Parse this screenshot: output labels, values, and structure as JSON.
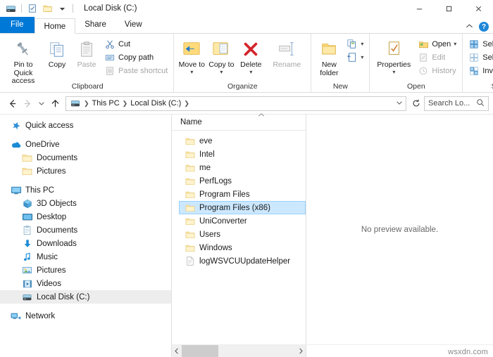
{
  "window": {
    "title": "Local Disk (C:)",
    "quick_access_icons": [
      "drive-icon",
      "properties-icon",
      "new-folder-icon",
      "customize-qat-chevron"
    ],
    "controls": {
      "minimize": "minimize-icon",
      "maximize": "maximize-icon",
      "close": "close-icon"
    },
    "ribbon_collapse": "chevron-up-icon",
    "help": "?"
  },
  "tabs": [
    {
      "label": "File",
      "state": "file"
    },
    {
      "label": "Home",
      "state": "active"
    },
    {
      "label": "Share",
      "state": "normal"
    },
    {
      "label": "View",
      "state": "normal"
    }
  ],
  "ribbon": {
    "groups": [
      {
        "label": "Clipboard",
        "big": [
          {
            "label": "Pin to Quick access",
            "icon": "pin-icon",
            "disabled": false
          },
          {
            "label": "Copy",
            "icon": "copy-icon",
            "disabled": false
          },
          {
            "label": "Paste",
            "icon": "paste-icon",
            "disabled": true
          }
        ],
        "small": [
          {
            "label": "Cut",
            "icon": "scissors-icon",
            "disabled": false
          },
          {
            "label": "Copy path",
            "icon": "copy-path-icon",
            "disabled": false
          },
          {
            "label": "Paste shortcut",
            "icon": "paste-shortcut-icon",
            "disabled": true
          }
        ]
      },
      {
        "label": "Organize",
        "big": [
          {
            "label": "Move to",
            "icon": "move-to-icon",
            "disabled": false,
            "caret": true
          },
          {
            "label": "Copy to",
            "icon": "copy-to-icon",
            "disabled": false,
            "caret": true
          },
          {
            "label": "Delete",
            "icon": "delete-x-icon",
            "disabled": false,
            "caret": true
          },
          {
            "label": "Rename",
            "icon": "rename-icon",
            "disabled": true
          }
        ],
        "small": []
      },
      {
        "label": "New",
        "big": [
          {
            "label": "New folder",
            "icon": "new-folder-icon",
            "disabled": false
          }
        ],
        "small": [
          {
            "label": "",
            "icon": "new-item-icon",
            "disabled": false,
            "caret": true
          },
          {
            "label": "",
            "icon": "easy-access-icon",
            "disabled": false,
            "caret": true
          }
        ]
      },
      {
        "label": "Open",
        "big": [
          {
            "label": "Properties",
            "icon": "properties-icon",
            "disabled": false,
            "caret": true
          }
        ],
        "small": [
          {
            "label": "Open",
            "icon": "open-icon",
            "disabled": false,
            "caret": true
          },
          {
            "label": "Edit",
            "icon": "edit-icon",
            "disabled": true
          },
          {
            "label": "History",
            "icon": "history-icon",
            "disabled": true
          }
        ]
      },
      {
        "label": "Select",
        "big": [],
        "small": [
          {
            "label": "Select all",
            "icon": "select-all-icon",
            "disabled": false
          },
          {
            "label": "Select none",
            "icon": "select-none-icon",
            "disabled": false
          },
          {
            "label": "Invert selection",
            "icon": "invert-selection-icon",
            "disabled": false
          }
        ]
      }
    ]
  },
  "addressbar": {
    "back": "back-arrow-icon",
    "forward": "forward-arrow-icon",
    "recent": "chevron-down-icon",
    "up": "up-arrow-icon",
    "path_icon": "drive-icon",
    "crumbs": [
      "This PC",
      "Local Disk (C:)"
    ],
    "dropdown": "chevron-down-icon",
    "refresh": "refresh-icon",
    "search_placeholder": "Search Lo...",
    "search_value": "",
    "search_icon": "search-icon"
  },
  "navpane": {
    "items": [
      {
        "label": "Quick access",
        "icon": "star-pin-icon",
        "indent": false,
        "selected": false,
        "gap_before": false
      },
      {
        "label": "OneDrive",
        "icon": "cloud-icon",
        "indent": false,
        "selected": false,
        "gap_before": true
      },
      {
        "label": "Documents",
        "icon": "folder-icon",
        "indent": true,
        "selected": false,
        "gap_before": false
      },
      {
        "label": "Pictures",
        "icon": "folder-icon",
        "indent": true,
        "selected": false,
        "gap_before": false
      },
      {
        "label": "This PC",
        "icon": "monitor-icon",
        "indent": false,
        "selected": false,
        "gap_before": true
      },
      {
        "label": "3D Objects",
        "icon": "cube-icon",
        "indent": true,
        "selected": false,
        "gap_before": false
      },
      {
        "label": "Desktop",
        "icon": "desktop-icon",
        "indent": true,
        "selected": false,
        "gap_before": false
      },
      {
        "label": "Documents",
        "icon": "documents-icon",
        "indent": true,
        "selected": false,
        "gap_before": false
      },
      {
        "label": "Downloads",
        "icon": "download-icon",
        "indent": true,
        "selected": false,
        "gap_before": false
      },
      {
        "label": "Music",
        "icon": "music-note-icon",
        "indent": true,
        "selected": false,
        "gap_before": false
      },
      {
        "label": "Pictures",
        "icon": "pictures-icon",
        "indent": true,
        "selected": false,
        "gap_before": false
      },
      {
        "label": "Videos",
        "icon": "videos-icon",
        "indent": true,
        "selected": false,
        "gap_before": false
      },
      {
        "label": "Local Disk (C:)",
        "icon": "drive-icon",
        "indent": true,
        "selected": true,
        "gap_before": false
      },
      {
        "label": "Network",
        "icon": "network-icon",
        "indent": false,
        "selected": false,
        "gap_before": true
      }
    ]
  },
  "filelist": {
    "column_header": "Name",
    "sort_indicator": "ascending",
    "rows": [
      {
        "name": "eve",
        "type": "folder",
        "selected": false
      },
      {
        "name": "Intel",
        "type": "folder",
        "selected": false
      },
      {
        "name": "me",
        "type": "folder",
        "selected": false
      },
      {
        "name": "PerfLogs",
        "type": "folder",
        "selected": false
      },
      {
        "name": "Program Files",
        "type": "folder",
        "selected": false
      },
      {
        "name": "Program Files (x86)",
        "type": "folder",
        "selected": true
      },
      {
        "name": "UniConverter",
        "type": "folder",
        "selected": false
      },
      {
        "name": "Users",
        "type": "folder",
        "selected": false
      },
      {
        "name": "Windows",
        "type": "folder",
        "selected": false
      },
      {
        "name": "logWSVCUUpdateHelper",
        "type": "file",
        "selected": false
      }
    ]
  },
  "preview": {
    "message": "No preview available."
  },
  "scrollbar": {
    "left_arrow": "chevron-left-icon",
    "right_arrow": "chevron-right-icon"
  },
  "watermark": "wsxdn.com",
  "colors": {
    "accent": "#0078d7",
    "selection_fill": "#cce8ff",
    "selection_border": "#99d1ff",
    "nav_selection": "#ededed",
    "folder_yellow": "#ffd97a",
    "folder_yellow_light": "#fff0c2",
    "close_hover": "#e81123",
    "text": "#1a1a1a",
    "disabled_text": "#a6a6a6"
  }
}
